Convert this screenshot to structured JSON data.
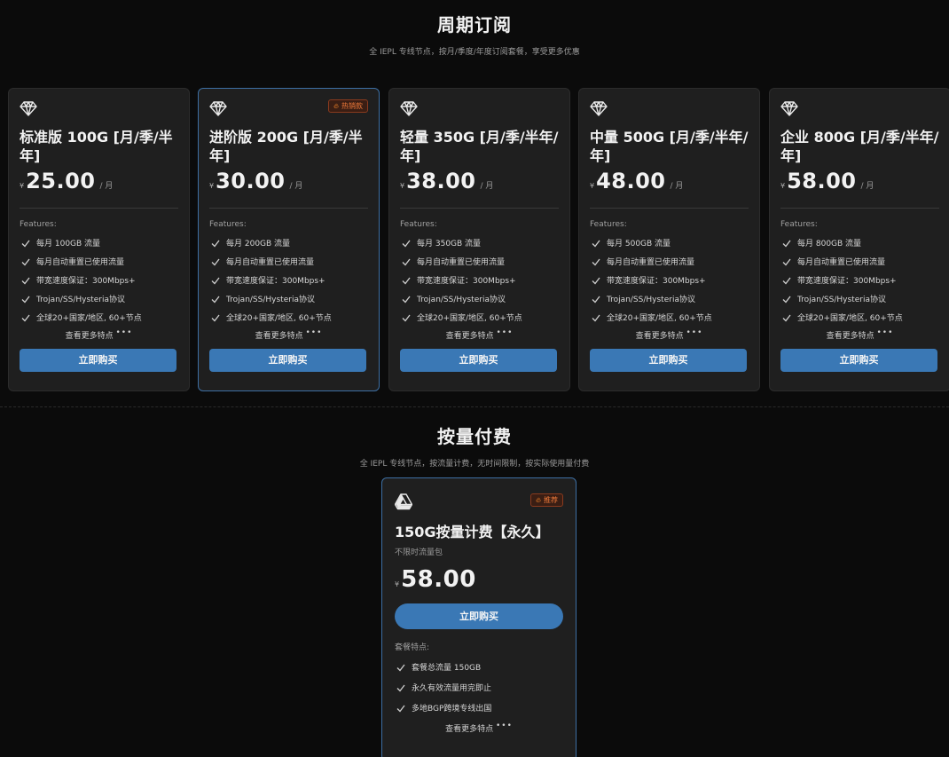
{
  "subscription": {
    "title": "周期订阅",
    "subtitle": "全 IEPL 专线节点，按月/季度/年度订阅套餐，享受更多优惠"
  },
  "plans": [
    {
      "name": "标准版 100G [月/季/半年]",
      "currency": "¥",
      "price": "25.00",
      "period": "/ 月",
      "badge": "",
      "features_label": "Features:",
      "features": [
        "每月 100GB 流量",
        "每月自动重置已使用流量",
        "带宽速度保证：300Mbps+",
        "Trojan/SS/Hysteria协议",
        "全球20+国家/地区, 60+节点"
      ],
      "more_label": "查看更多特点",
      "more_dots": "•••",
      "buy_label": "立即购买"
    },
    {
      "name": "进阶版 200G [月/季/半年]",
      "currency": "¥",
      "price": "30.00",
      "period": "/ 月",
      "badge": "热销款",
      "features_label": "Features:",
      "features": [
        "每月 200GB 流量",
        "每月自动重置已使用流量",
        "带宽速度保证：300Mbps+",
        "Trojan/SS/Hysteria协议",
        "全球20+国家/地区, 60+节点"
      ],
      "more_label": "查看更多特点",
      "more_dots": "•••",
      "buy_label": "立即购买"
    },
    {
      "name": "轻量 350G [月/季/半年/年]",
      "currency": "¥",
      "price": "38.00",
      "period": "/ 月",
      "badge": "",
      "features_label": "Features:",
      "features": [
        "每月 350GB 流量",
        "每月自动重置已使用流量",
        "带宽速度保证：300Mbps+",
        "Trojan/SS/Hysteria协议",
        "全球20+国家/地区, 60+节点"
      ],
      "more_label": "查看更多特点",
      "more_dots": "•••",
      "buy_label": "立即购买"
    },
    {
      "name": "中量 500G [月/季/半年/年]",
      "currency": "¥",
      "price": "48.00",
      "period": "/ 月",
      "badge": "",
      "features_label": "Features:",
      "features": [
        "每月 500GB 流量",
        "每月自动重置已使用流量",
        "带宽速度保证：300Mbps+",
        "Trojan/SS/Hysteria协议",
        "全球20+国家/地区, 60+节点"
      ],
      "more_label": "查看更多特点",
      "more_dots": "•••",
      "buy_label": "立即购买"
    },
    {
      "name": "企业 800G [月/季/半年/年]",
      "currency": "¥",
      "price": "58.00",
      "period": "/ 月",
      "badge": "",
      "features_label": "Features:",
      "features": [
        "每月 800GB 流量",
        "每月自动重置已使用流量",
        "带宽速度保证：300Mbps+",
        "Trojan/SS/Hysteria协议",
        "全球20+国家/地区, 60+节点"
      ],
      "more_label": "查看更多特点",
      "more_dots": "•••",
      "buy_label": "立即购买"
    }
  ],
  "payg": {
    "title": "按量付费",
    "subtitle": "全 IEPL 专线节点，按流量计费，无时间限制，按实际使用量付费",
    "card": {
      "icon": "google-drive-icon",
      "badge": "推荐",
      "name": "150G按量计费【永久】",
      "subtitle": "不限时流量包",
      "currency": "¥",
      "price": "58.00",
      "buy_label": "立即购买",
      "features_label": "套餐特点:",
      "features": [
        "套餐总流量 150GB",
        "永久有效流量用完即止",
        "多地BGP跨境专线出国"
      ],
      "more_label": "查看更多特点",
      "more_dots": "•••"
    }
  },
  "icons": {
    "plan": "diamond-icon",
    "check": "check-icon",
    "badge": "flame-icon"
  },
  "colors": {
    "accent": "#3a78b5",
    "featured_border": "#3d6fa3",
    "badge": "#f07a3a",
    "card_bg": "#1f1f1f",
    "page_bg": "#0b0b0b"
  }
}
